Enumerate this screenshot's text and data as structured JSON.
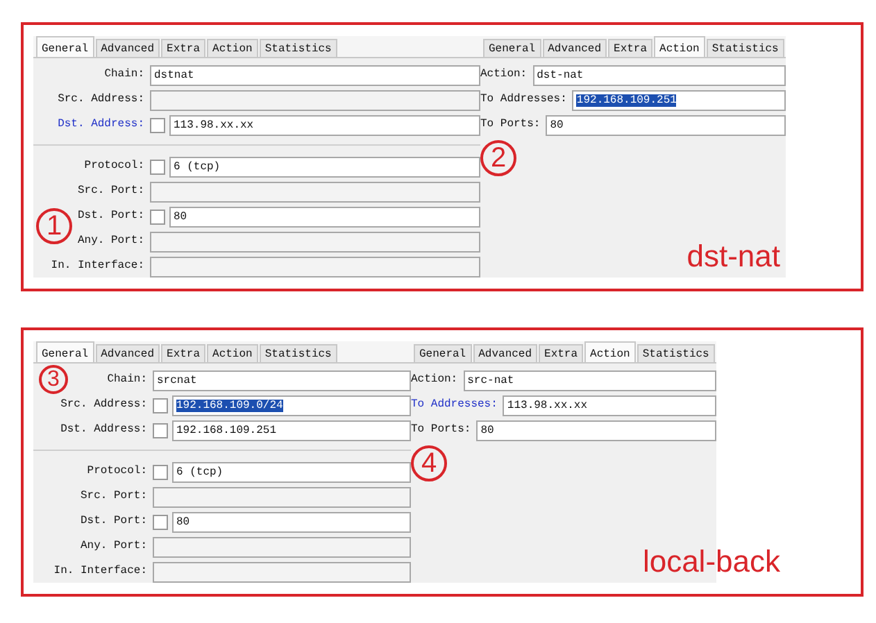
{
  "sections": [
    {
      "caption": "dst-nat",
      "panels": [
        {
          "marker": "1",
          "tabs": [
            {
              "label": "General",
              "selected": true
            },
            {
              "label": "Advanced",
              "selected": false
            },
            {
              "label": "Extra",
              "selected": false
            },
            {
              "label": "Action",
              "selected": false
            },
            {
              "label": "Statistics",
              "selected": false
            }
          ],
          "groups": [
            [
              {
                "label": "Chain:",
                "kind": "plain",
                "value": "dstnat",
                "changed": false,
                "highlighted": false
              },
              {
                "label": "Src. Address:",
                "kind": "plain",
                "changed": false
              },
              {
                "label": "Dst. Address:",
                "kind": "negatable",
                "checked": false,
                "value": "113.98.xx.xx",
                "changed": true,
                "highlighted": false
              }
            ],
            [
              {
                "label": "Protocol:",
                "kind": "negatable",
                "checked": false,
                "value": "6 (tcp)",
                "changed": false,
                "highlighted": false
              },
              {
                "label": "Src. Port:",
                "kind": "plain",
                "changed": false
              },
              {
                "label": "Dst. Port:",
                "kind": "negatable",
                "checked": false,
                "value": "80",
                "changed": false,
                "highlighted": false
              },
              {
                "label": "Any. Port:",
                "kind": "plain",
                "changed": false
              },
              {
                "label": "In. Interface:",
                "kind": "plain",
                "changed": false
              }
            ]
          ]
        },
        {
          "marker": "2",
          "tabs": [
            {
              "label": "General",
              "selected": false
            },
            {
              "label": "Advanced",
              "selected": false
            },
            {
              "label": "Extra",
              "selected": false
            },
            {
              "label": "Action",
              "selected": true
            },
            {
              "label": "Statistics",
              "selected": false
            }
          ],
          "groups": [
            [
              {
                "label": "Action:",
                "kind": "plain",
                "value": "dst-nat",
                "changed": false,
                "highlighted": false
              },
              {
                "label": "To Addresses:",
                "kind": "plain",
                "value": "192.168.109.251",
                "changed": false,
                "highlighted": true
              },
              {
                "label": "To Ports:",
                "kind": "plain",
                "value": "80",
                "changed": false,
                "highlighted": false
              }
            ]
          ]
        }
      ]
    },
    {
      "caption": "local-back",
      "panels": [
        {
          "marker": "3",
          "tabs": [
            {
              "label": "General",
              "selected": true
            },
            {
              "label": "Advanced",
              "selected": false
            },
            {
              "label": "Extra",
              "selected": false
            },
            {
              "label": "Action",
              "selected": false
            },
            {
              "label": "Statistics",
              "selected": false
            }
          ],
          "groups": [
            [
              {
                "label": "Chain:",
                "kind": "plain",
                "value": "srcnat",
                "changed": false,
                "highlighted": false
              },
              {
                "label": "Src. Address:",
                "kind": "negatable",
                "checked": false,
                "value": "192.168.109.0/24",
                "changed": false,
                "highlighted": true
              },
              {
                "label": "Dst. Address:",
                "kind": "negatable",
                "checked": false,
                "value": "192.168.109.251",
                "changed": false,
                "highlighted": false
              }
            ],
            [
              {
                "label": "Protocol:",
                "kind": "negatable",
                "checked": false,
                "value": "6 (tcp)",
                "changed": false,
                "highlighted": false
              },
              {
                "label": "Src. Port:",
                "kind": "plain",
                "changed": false
              },
              {
                "label": "Dst. Port:",
                "kind": "negatable",
                "checked": false,
                "value": "80",
                "changed": false,
                "highlighted": false
              },
              {
                "label": "Any. Port:",
                "kind": "plain",
                "changed": false
              },
              {
                "label": "In. Interface:",
                "kind": "plain",
                "changed": false
              }
            ]
          ]
        },
        {
          "marker": "4",
          "tabs": [
            {
              "label": "General",
              "selected": false
            },
            {
              "label": "Advanced",
              "selected": false
            },
            {
              "label": "Extra",
              "selected": false
            },
            {
              "label": "Action",
              "selected": true
            },
            {
              "label": "Statistics",
              "selected": false
            }
          ],
          "groups": [
            [
              {
                "label": "Action:",
                "kind": "plain",
                "value": "src-nat",
                "changed": false,
                "highlighted": false
              },
              {
                "label": "To Addresses:",
                "kind": "plain",
                "value": "113.98.xx.xx",
                "changed": true,
                "highlighted": false
              },
              {
                "label": "To Ports:",
                "kind": "plain",
                "value": "80",
                "changed": false,
                "highlighted": false
              }
            ]
          ]
        }
      ]
    }
  ]
}
